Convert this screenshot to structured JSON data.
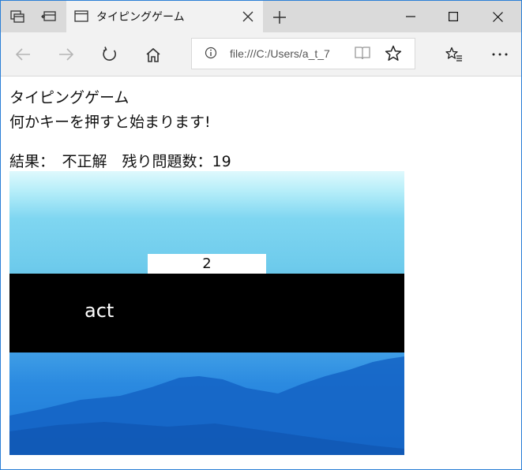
{
  "browser": {
    "tab_title": "タイピングゲーム",
    "address": "file:///C:/Users/a_t_7",
    "icons": [
      "tabs-aside-icon",
      "tab-preview-icon",
      "page-icon",
      "close-tab-icon",
      "new-tab-icon",
      "minimize-icon",
      "maximize-icon",
      "close-window-icon",
      "back-icon",
      "forward-icon",
      "refresh-icon",
      "home-icon",
      "info-icon",
      "reading-view-icon",
      "favorite-star-icon",
      "favorites-hub-icon",
      "more-icon"
    ]
  },
  "page": {
    "heading": "タイピングゲーム",
    "instruction": "何かキーを押すと始まります!",
    "result_line": "結果：　不正解　残り問題数：19",
    "game": {
      "count": "2",
      "word": "act"
    }
  }
}
